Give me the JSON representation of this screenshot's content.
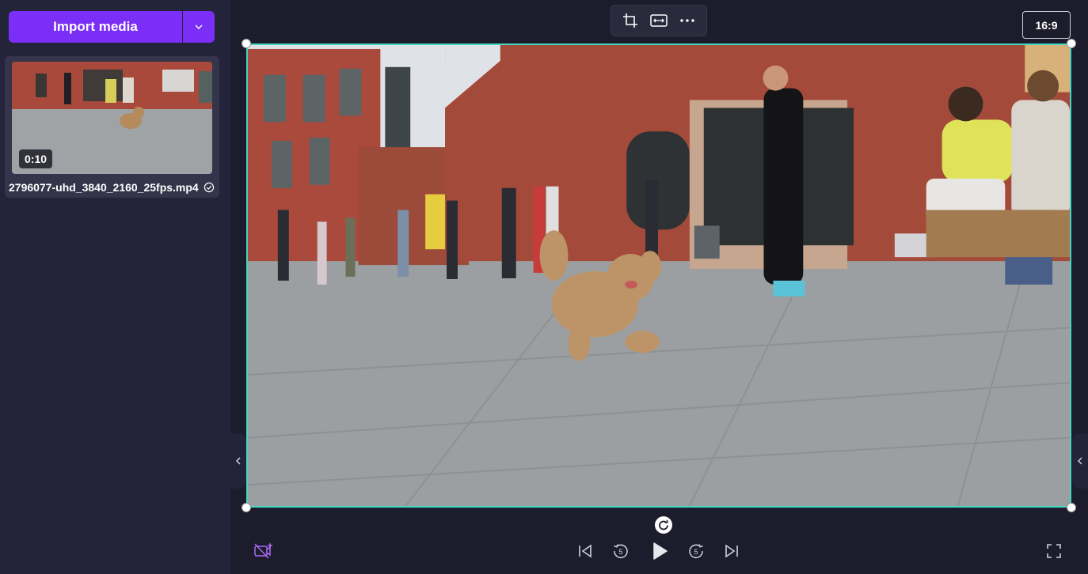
{
  "media_panel": {
    "import_label": "Import media",
    "item": {
      "duration": "0:10",
      "filename": "2796077-uhd_3840_2160_25fps.mp4"
    }
  },
  "toolbar": {
    "icons": [
      "crop-icon",
      "fit-icon",
      "more-icon"
    ],
    "aspect_ratio": "16:9"
  },
  "playback": {
    "icons": [
      "skip-to-start-icon",
      "rewind-5-icon",
      "play-icon",
      "forward-5-icon",
      "skip-to-end-icon"
    ],
    "skip_seconds": "5"
  },
  "colors": {
    "accent": "#7b2ff6",
    "selection": "#43d6c0",
    "background": "#1c1c2c",
    "panel": "#23233a"
  }
}
